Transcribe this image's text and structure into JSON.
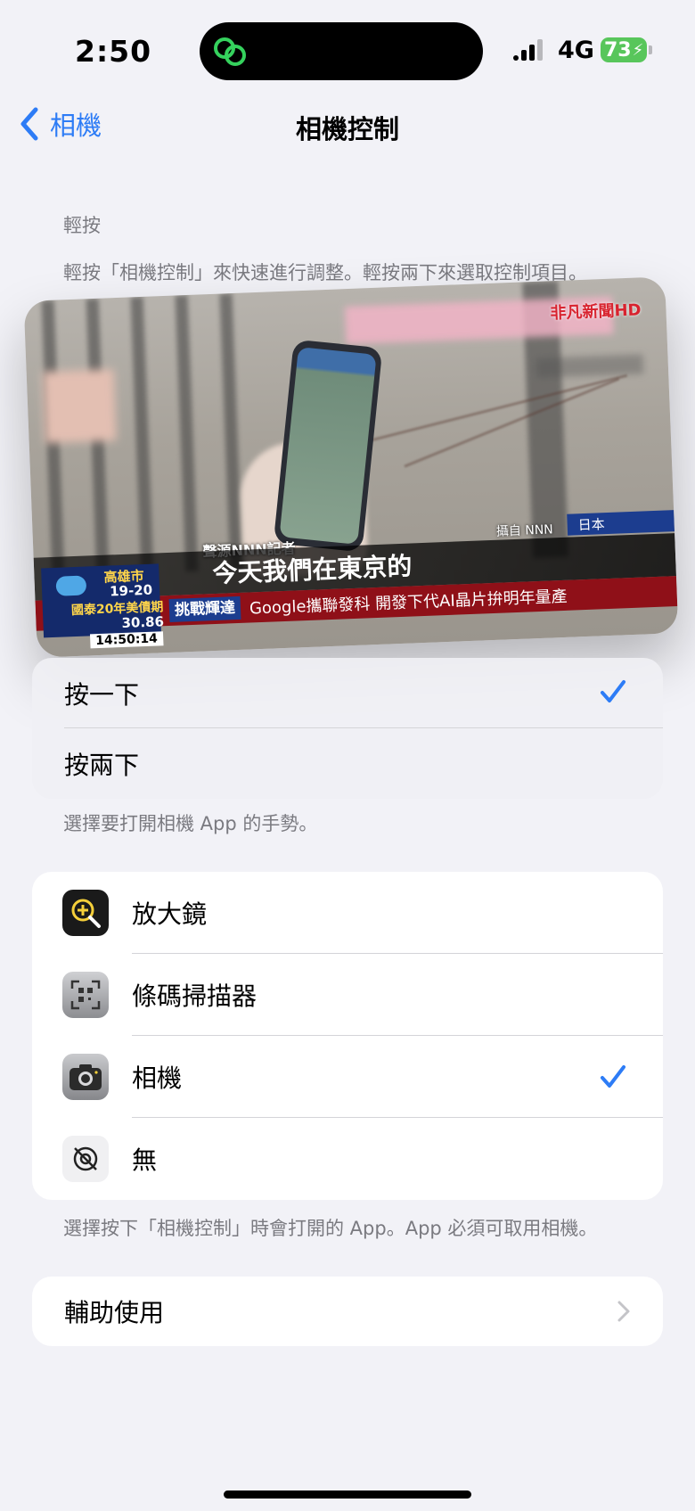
{
  "status_bar": {
    "time": "2:50",
    "network": "4G",
    "battery": "73",
    "battery_color": "#58c65b"
  },
  "nav": {
    "back_label": "相機",
    "title": "相機控制"
  },
  "section": {
    "header": "輕按",
    "description": "輕按「相機控制」來快速進行調整。輕按兩下來選取控制項目。"
  },
  "preview": {
    "logo": "非凡新聞HD",
    "credit": "聲源NNN記者",
    "camera_credit": "攝自 NNN",
    "location": "日本",
    "subtitle": "今天我們在東京的",
    "tag": "挑戰輝達",
    "ticker": "Google攜聯發科 開發下代AI晶片拚明年量產",
    "weather_city": "高雄市",
    "weather_temp": "19-20",
    "stock_name": "國泰20年美債期",
    "stock_value": "30.86",
    "clock": "14:50:14"
  },
  "gesture": {
    "options": [
      {
        "label": "按一下",
        "selected": true
      },
      {
        "label": "按兩下",
        "selected": false
      }
    ],
    "footnote": "選擇要打開相機 App 的手勢。"
  },
  "apps": {
    "options": [
      {
        "label": "放大鏡",
        "icon": "magnifier-icon",
        "selected": false
      },
      {
        "label": "條碼掃描器",
        "icon": "qr-scanner-icon",
        "selected": false
      },
      {
        "label": "相機",
        "icon": "camera-icon",
        "selected": true
      },
      {
        "label": "無",
        "icon": "none-icon",
        "selected": false
      }
    ],
    "footnote": "選擇按下「相機控制」時會打開的 App。App 必須可取用相機。"
  },
  "accessibility": {
    "label": "輔助使用"
  },
  "colors": {
    "accent": "#2d7cf6",
    "background": "#f2f2f7"
  }
}
